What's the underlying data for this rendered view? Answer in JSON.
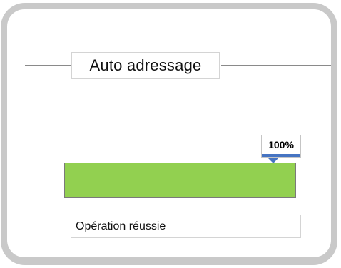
{
  "dialog": {
    "title": "Auto adressage"
  },
  "progress": {
    "value": 1.0,
    "label": "100%",
    "fill_color": "#92d050",
    "accent_color": "#4674c2"
  },
  "status": {
    "message": "Opération réussie"
  }
}
